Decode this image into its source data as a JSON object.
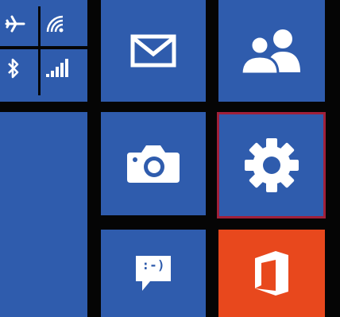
{
  "tiles": {
    "mail": {
      "icon": "mail-icon"
    },
    "people": {
      "icon": "people-icon"
    },
    "camera": {
      "icon": "camera-icon"
    },
    "settings": {
      "icon": "gear-icon"
    },
    "messaging": {
      "icon": "message-bubble-icon",
      "emoticon": ":-)"
    },
    "office": {
      "icon": "office-icon"
    }
  },
  "status_tile": {
    "icons": [
      "airplane-icon",
      "wifi-icon",
      "bluetooth-icon",
      "signal-bars-icon"
    ]
  },
  "colors": {
    "tile_blue": "#2f5cad",
    "office_orange": "#e8481d",
    "selection_border": "#a0203a",
    "background": "#050505"
  }
}
